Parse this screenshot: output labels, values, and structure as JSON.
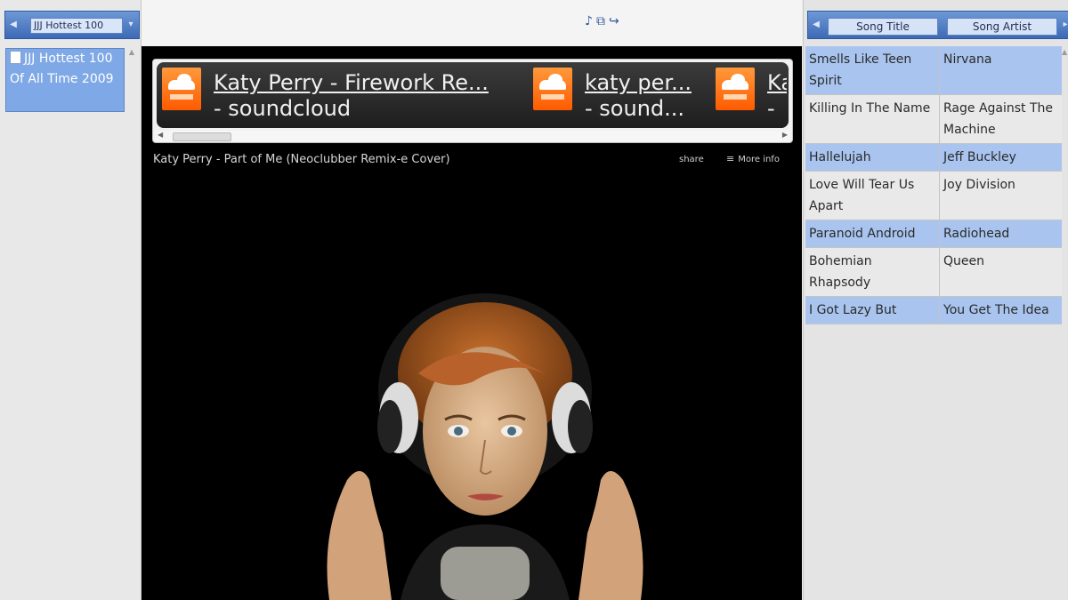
{
  "left_panel": {
    "selected_playlist": "JJJ Hottest 100",
    "playlists": [
      {
        "label": "JJJ Hottest 100 Of All Time 2009"
      }
    ]
  },
  "toolbar": {
    "icons": [
      "music-note-icon",
      "copy-icon",
      "redo-icon"
    ]
  },
  "widget": {
    "tracks": [
      {
        "title": "Katy Perry - Firework Re...",
        "source": "- soundcloud"
      },
      {
        "title": "katy per...",
        "source": "- sound..."
      },
      {
        "title": "Ka",
        "source": "-"
      }
    ]
  },
  "video": {
    "title": "Katy Perry - Part of Me (Neoclubber Remix-e Cover)",
    "share_label": "share",
    "more_info_label": "More info"
  },
  "song_table": {
    "columns": [
      "Song Title",
      "Song Artist"
    ],
    "rows": [
      {
        "title": "Smells Like Teen Spirit",
        "artist": "Nirvana",
        "highlight": true
      },
      {
        "title": "Killing In The Name",
        "artist": "Rage Against The Machine",
        "highlight": false
      },
      {
        "title": "Hallelujah",
        "artist": "Jeff Buckley",
        "highlight": true
      },
      {
        "title": "Love Will Tear Us Apart",
        "artist": "Joy Division",
        "highlight": false
      },
      {
        "title": "Paranoid Android",
        "artist": "Radiohead",
        "highlight": true
      },
      {
        "title": "Bohemian Rhapsody",
        "artist": "Queen",
        "highlight": false
      },
      {
        "title": "I Got Lazy But",
        "artist": "You Get The Idea",
        "highlight": true
      }
    ]
  },
  "colors": {
    "header_blue": "#3d6ab6",
    "row_highlight": "#a9c5ef",
    "soundcloud_orange": "#ff5a00"
  }
}
